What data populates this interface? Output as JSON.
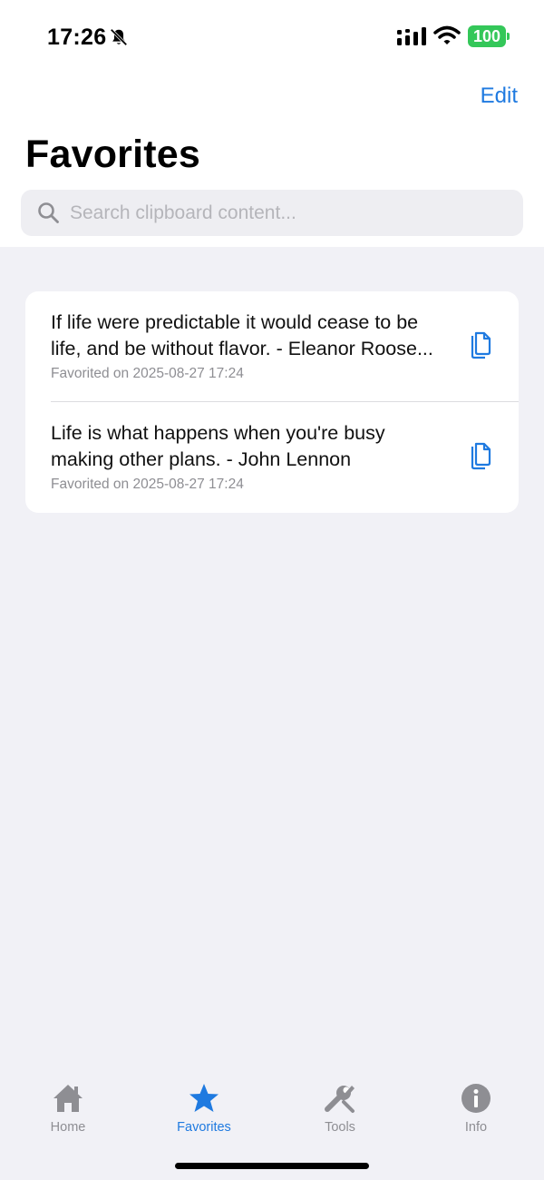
{
  "status_bar": {
    "time": "17:26",
    "battery": "100",
    "battery_color": "#34c759",
    "icons": [
      "bell-slash-icon",
      "cellular-signal-icon",
      "wifi-icon",
      "battery-icon"
    ]
  },
  "nav": {
    "edit_label": "Edit",
    "title": "Favorites"
  },
  "search": {
    "placeholder": "Search clipboard content...",
    "value": ""
  },
  "favorites": [
    {
      "text_line1": "If life were predictable it would cease to be",
      "text_line2": "life, and be without flavor. - Eleanor Roose...",
      "date": "Favorited on 2025-08-27 17:24"
    },
    {
      "text_line1": "Life is what happens when you're busy",
      "text_line2": "making other plans. - John Lennon",
      "date": "Favorited on 2025-08-27 17:24"
    }
  ],
  "tabs": [
    {
      "label": "Home",
      "icon": "house-icon",
      "active": false
    },
    {
      "label": "Favorites",
      "icon": "star-icon",
      "active": true
    },
    {
      "label": "Tools",
      "icon": "wrench-screwdriver-icon",
      "active": false
    },
    {
      "label": "Info",
      "icon": "info-circle-icon",
      "active": false
    }
  ],
  "colors": {
    "accent": "#1f7ae0",
    "inactive": "#8e8e93",
    "background": "#f1f1f6"
  }
}
